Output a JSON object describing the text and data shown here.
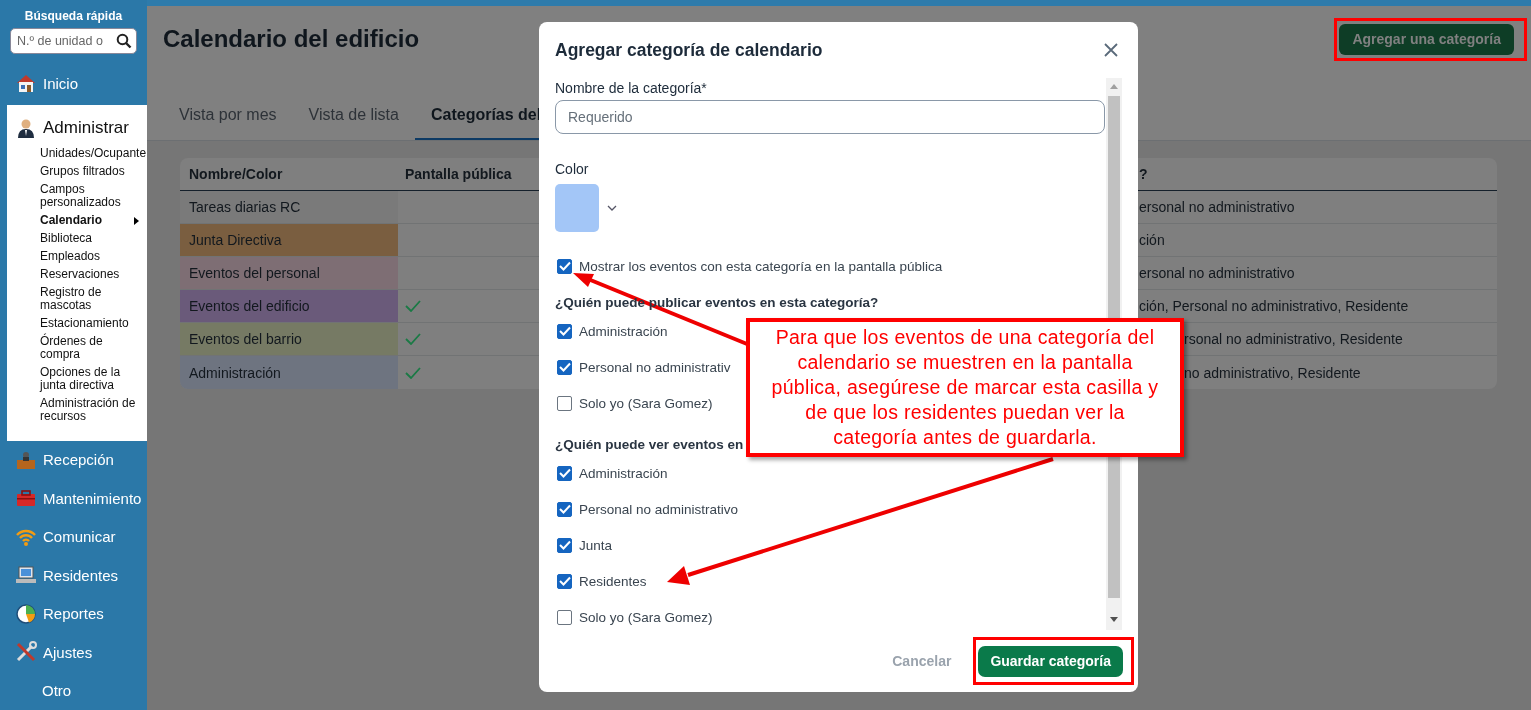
{
  "sidebar": {
    "search_title": "Búsqueda rápida",
    "search": {
      "placeholder": "N.º de unidad o"
    },
    "items": [
      {
        "label": "Inicio",
        "kind": "house",
        "expanded": false
      },
      {
        "label": "Administrar",
        "kind": "person",
        "expanded": true,
        "children": [
          {
            "label": "Unidades/Ocupante",
            "selected": false
          },
          {
            "label": "Grupos filtrados",
            "selected": false
          },
          {
            "label": "Campos personalizados",
            "selected": false
          },
          {
            "label": "Calendario",
            "selected": true
          },
          {
            "label": "Biblioteca",
            "selected": false
          },
          {
            "label": "Empleados",
            "selected": false
          },
          {
            "label": "Reservaciones",
            "selected": false
          },
          {
            "label": "Registro de mascotas",
            "selected": false
          },
          {
            "label": "Estacionamiento",
            "selected": false
          },
          {
            "label": "Órdenes de compra",
            "selected": false
          },
          {
            "label": "Opciones de la junta directiva",
            "selected": false
          },
          {
            "label": "Administración de recursos",
            "selected": false
          }
        ]
      },
      {
        "label": "Recepción",
        "kind": "desk",
        "expanded": false
      },
      {
        "label": "Mantenimiento",
        "kind": "toolbox",
        "expanded": false
      },
      {
        "label": "Comunicar",
        "kind": "wifi",
        "expanded": false
      },
      {
        "label": "Residentes",
        "kind": "laptop",
        "expanded": false
      },
      {
        "label": "Reportes",
        "kind": "pie",
        "expanded": false
      },
      {
        "label": "Ajustes",
        "kind": "tools",
        "expanded": false
      },
      {
        "label": "Otro",
        "kind": "plain",
        "expanded": false
      }
    ]
  },
  "page": {
    "title": "Calendario del edificio",
    "add_button": "Agregar una categoría",
    "tabs": [
      {
        "label": "Vista por mes",
        "selected": false
      },
      {
        "label": "Vista de lista",
        "selected": false
      },
      {
        "label": "Categorías del",
        "selected": true
      }
    ],
    "table": {
      "columns": [
        "Nombre/Color",
        "Pantalla pública",
        "?"
      ],
      "rows": [
        {
          "name": "Tareas diarias RC",
          "color": "#7a7a7a",
          "public_screen": false,
          "column_3": "ersonal no administrativo"
        },
        {
          "name": "Junta Directiva",
          "color": "#7a5e40",
          "public_screen": false,
          "column_3": "ción"
        },
        {
          "name": "Eventos del personal",
          "color": "#7e6e74",
          "public_screen": false,
          "column_3": "ersonal no administrativo"
        },
        {
          "name": "Eventos del edificio",
          "color": "#6a5a7a",
          "public_screen": true,
          "column_3": "ción, Personal no administrativo, Residente"
        },
        {
          "name": "Eventos del barrio",
          "color": "#767a64",
          "public_screen": true,
          "column_3": "rsonal no administrativo, Residente"
        },
        {
          "name": "Administración",
          "color": "#6e7480",
          "public_screen": true,
          "column_3": "no administrativo, Residente"
        }
      ]
    }
  },
  "dialog": {
    "title": "Agregar categoría de calendario",
    "name_field": {
      "label": "Nombre de la categoría*",
      "placeholder": "Requerido"
    },
    "color_field": {
      "label": "Color",
      "color": "#a3c6f7"
    },
    "show_public": {
      "label": "Mostrar los eventos con esta categoría en la pantalla pública",
      "checked": true
    },
    "groups": [
      {
        "label": "¿Quién puede publicar eventos en esta categoría?",
        "options": [
          {
            "label": "Administración",
            "checked": true
          },
          {
            "label": "Personal no administrativ",
            "checked": true
          },
          {
            "label": "Solo yo (Sara Gomez)",
            "checked": false
          }
        ]
      },
      {
        "label": "¿Quién puede ver eventos en",
        "options": [
          {
            "label": "Administración",
            "checked": true
          },
          {
            "label": "Personal no administrativo",
            "checked": true
          },
          {
            "label": "Junta",
            "checked": true
          },
          {
            "label": "Residentes",
            "checked": true
          },
          {
            "label": "Solo yo (Sara Gomez)",
            "checked": false
          }
        ]
      }
    ],
    "cancel": "Cancelar",
    "save": "Guardar categoría"
  },
  "annotation": {
    "callout": "Para que los eventos de una categoría del calendario se muestren en la pantalla pública, asegúrese de marcar esta casilla y de que los residentes puedan ver la categoría antes de guardarla."
  }
}
